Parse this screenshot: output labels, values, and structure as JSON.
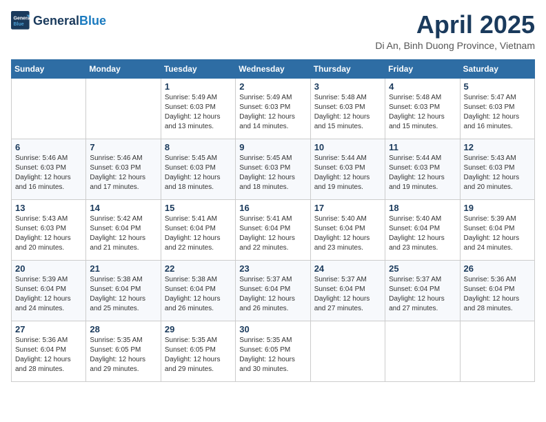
{
  "logo": {
    "general": "General",
    "blue": "Blue"
  },
  "title": "April 2025",
  "location": "Di An, Binh Duong Province, Vietnam",
  "days_of_week": [
    "Sunday",
    "Monday",
    "Tuesday",
    "Wednesday",
    "Thursday",
    "Friday",
    "Saturday"
  ],
  "weeks": [
    [
      {
        "day": "",
        "detail": ""
      },
      {
        "day": "",
        "detail": ""
      },
      {
        "day": "1",
        "detail": "Sunrise: 5:49 AM\nSunset: 6:03 PM\nDaylight: 12 hours and 13 minutes."
      },
      {
        "day": "2",
        "detail": "Sunrise: 5:49 AM\nSunset: 6:03 PM\nDaylight: 12 hours and 14 minutes."
      },
      {
        "day": "3",
        "detail": "Sunrise: 5:48 AM\nSunset: 6:03 PM\nDaylight: 12 hours and 15 minutes."
      },
      {
        "day": "4",
        "detail": "Sunrise: 5:48 AM\nSunset: 6:03 PM\nDaylight: 12 hours and 15 minutes."
      },
      {
        "day": "5",
        "detail": "Sunrise: 5:47 AM\nSunset: 6:03 PM\nDaylight: 12 hours and 16 minutes."
      }
    ],
    [
      {
        "day": "6",
        "detail": "Sunrise: 5:46 AM\nSunset: 6:03 PM\nDaylight: 12 hours and 16 minutes."
      },
      {
        "day": "7",
        "detail": "Sunrise: 5:46 AM\nSunset: 6:03 PM\nDaylight: 12 hours and 17 minutes."
      },
      {
        "day": "8",
        "detail": "Sunrise: 5:45 AM\nSunset: 6:03 PM\nDaylight: 12 hours and 18 minutes."
      },
      {
        "day": "9",
        "detail": "Sunrise: 5:45 AM\nSunset: 6:03 PM\nDaylight: 12 hours and 18 minutes."
      },
      {
        "day": "10",
        "detail": "Sunrise: 5:44 AM\nSunset: 6:03 PM\nDaylight: 12 hours and 19 minutes."
      },
      {
        "day": "11",
        "detail": "Sunrise: 5:44 AM\nSunset: 6:03 PM\nDaylight: 12 hours and 19 minutes."
      },
      {
        "day": "12",
        "detail": "Sunrise: 5:43 AM\nSunset: 6:03 PM\nDaylight: 12 hours and 20 minutes."
      }
    ],
    [
      {
        "day": "13",
        "detail": "Sunrise: 5:43 AM\nSunset: 6:03 PM\nDaylight: 12 hours and 20 minutes."
      },
      {
        "day": "14",
        "detail": "Sunrise: 5:42 AM\nSunset: 6:04 PM\nDaylight: 12 hours and 21 minutes."
      },
      {
        "day": "15",
        "detail": "Sunrise: 5:41 AM\nSunset: 6:04 PM\nDaylight: 12 hours and 22 minutes."
      },
      {
        "day": "16",
        "detail": "Sunrise: 5:41 AM\nSunset: 6:04 PM\nDaylight: 12 hours and 22 minutes."
      },
      {
        "day": "17",
        "detail": "Sunrise: 5:40 AM\nSunset: 6:04 PM\nDaylight: 12 hours and 23 minutes."
      },
      {
        "day": "18",
        "detail": "Sunrise: 5:40 AM\nSunset: 6:04 PM\nDaylight: 12 hours and 23 minutes."
      },
      {
        "day": "19",
        "detail": "Sunrise: 5:39 AM\nSunset: 6:04 PM\nDaylight: 12 hours and 24 minutes."
      }
    ],
    [
      {
        "day": "20",
        "detail": "Sunrise: 5:39 AM\nSunset: 6:04 PM\nDaylight: 12 hours and 24 minutes."
      },
      {
        "day": "21",
        "detail": "Sunrise: 5:38 AM\nSunset: 6:04 PM\nDaylight: 12 hours and 25 minutes."
      },
      {
        "day": "22",
        "detail": "Sunrise: 5:38 AM\nSunset: 6:04 PM\nDaylight: 12 hours and 26 minutes."
      },
      {
        "day": "23",
        "detail": "Sunrise: 5:37 AM\nSunset: 6:04 PM\nDaylight: 12 hours and 26 minutes."
      },
      {
        "day": "24",
        "detail": "Sunrise: 5:37 AM\nSunset: 6:04 PM\nDaylight: 12 hours and 27 minutes."
      },
      {
        "day": "25",
        "detail": "Sunrise: 5:37 AM\nSunset: 6:04 PM\nDaylight: 12 hours and 27 minutes."
      },
      {
        "day": "26",
        "detail": "Sunrise: 5:36 AM\nSunset: 6:04 PM\nDaylight: 12 hours and 28 minutes."
      }
    ],
    [
      {
        "day": "27",
        "detail": "Sunrise: 5:36 AM\nSunset: 6:04 PM\nDaylight: 12 hours and 28 minutes."
      },
      {
        "day": "28",
        "detail": "Sunrise: 5:35 AM\nSunset: 6:05 PM\nDaylight: 12 hours and 29 minutes."
      },
      {
        "day": "29",
        "detail": "Sunrise: 5:35 AM\nSunset: 6:05 PM\nDaylight: 12 hours and 29 minutes."
      },
      {
        "day": "30",
        "detail": "Sunrise: 5:35 AM\nSunset: 6:05 PM\nDaylight: 12 hours and 30 minutes."
      },
      {
        "day": "",
        "detail": ""
      },
      {
        "day": "",
        "detail": ""
      },
      {
        "day": "",
        "detail": ""
      }
    ]
  ]
}
